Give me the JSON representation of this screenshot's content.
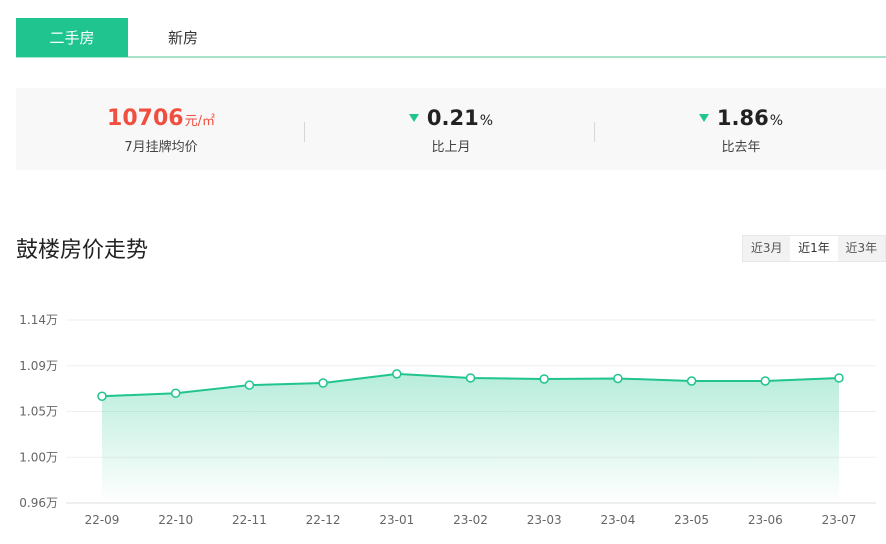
{
  "tabs": {
    "secondhand": "二手房",
    "newhouse": "新房"
  },
  "stats": {
    "price": {
      "value": "10706",
      "unit": "元/㎡",
      "label": "7月挂牌均价"
    },
    "mom": {
      "value": "0.21",
      "unit": "%",
      "label": "比上月",
      "direction": "down"
    },
    "yoy": {
      "value": "1.86",
      "unit": "%",
      "label": "比去年",
      "direction": "down"
    }
  },
  "section": {
    "title": "鼓楼房价走势"
  },
  "range": {
    "options": [
      "近3月",
      "近1年",
      "近3年"
    ],
    "selected": "近1年"
  },
  "colors": {
    "accent": "#1fc48f",
    "price": "#f04f3f"
  },
  "chart_data": {
    "type": "area",
    "title": "",
    "xlabel": "",
    "ylabel": "",
    "categories": [
      "22-09",
      "22-10",
      "22-11",
      "22-12",
      "23-01",
      "23-02",
      "23-03",
      "23-04",
      "23-05",
      "23-06",
      "23-07"
    ],
    "series": [
      {
        "values": [
          10650,
          10680,
          10760,
          10780,
          10870,
          10830,
          10820,
          10825,
          10800,
          10800,
          10830
        ]
      }
    ],
    "ylim": [
      9600,
      11400
    ],
    "yticks": [
      {
        "value": 9600,
        "label": "0.96万"
      },
      {
        "value": 10050,
        "label": "1.00万"
      },
      {
        "value": 10500,
        "label": "1.05万"
      },
      {
        "value": 10950,
        "label": "1.09万"
      },
      {
        "value": 11400,
        "label": "1.14万"
      }
    ],
    "grid": true,
    "legend": "none"
  }
}
